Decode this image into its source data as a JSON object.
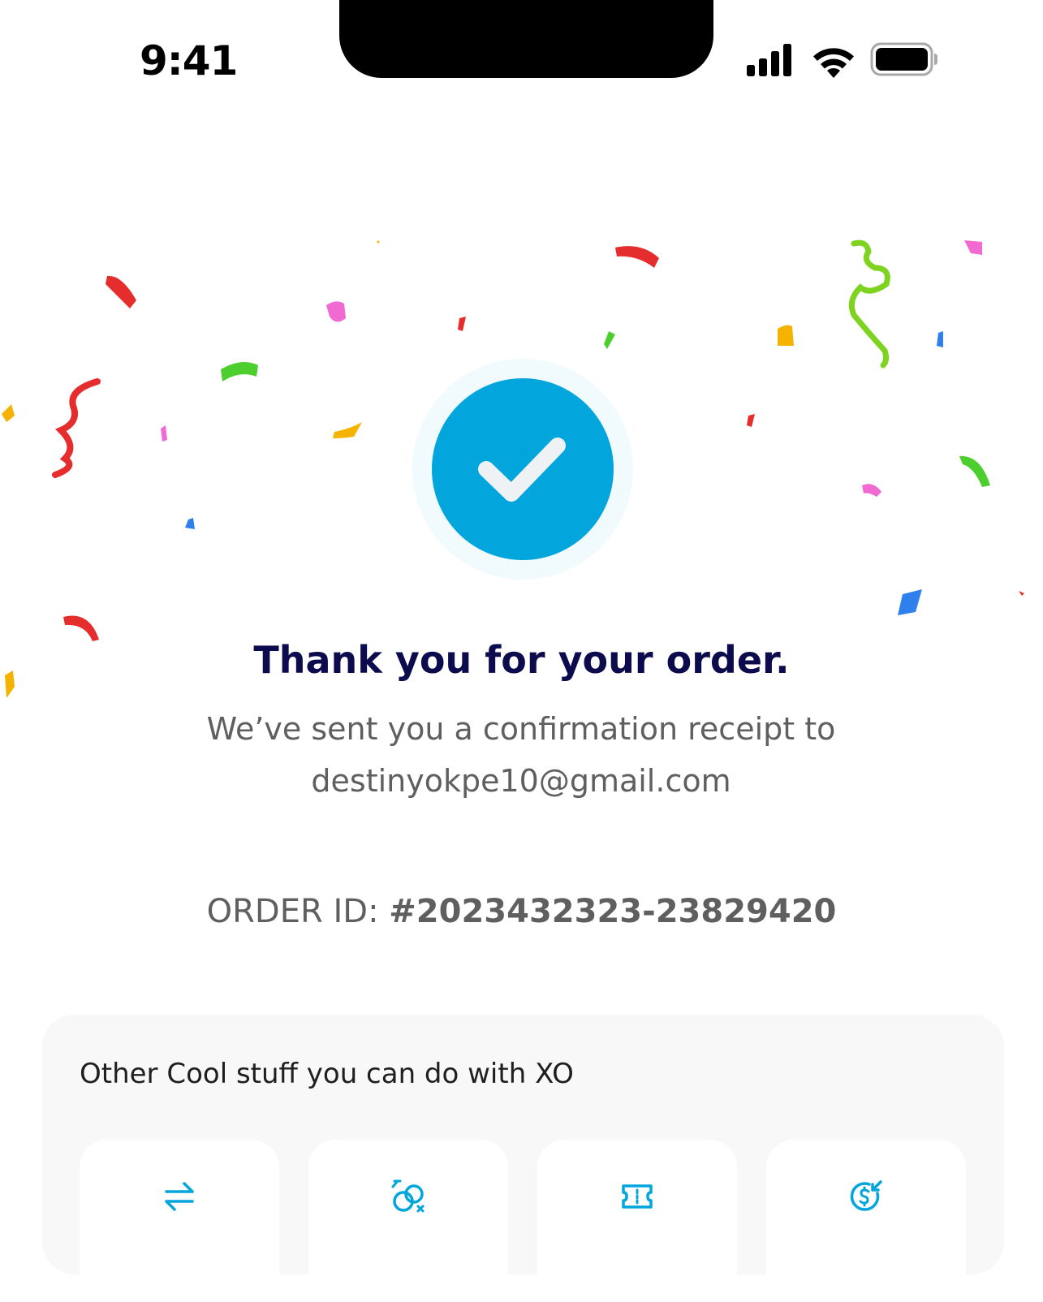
{
  "status_bar": {
    "time": "9:41"
  },
  "confirmation": {
    "icon": "checkmark-icon",
    "title": "Thank you for your order.",
    "message_line1": "We’ve sent you a confirmation receipt to",
    "email": "destinyokpe10@gmail.com",
    "order_label": "ORDER ID:",
    "order_id": "#2023432323-23829420"
  },
  "colors": {
    "accent": "#03a6dc",
    "title": "#0b0b4e",
    "text_muted": "#5f5f5f",
    "card_bg": "#f8f8f8"
  },
  "extras": {
    "title": "Other Cool stuff you can do with XO",
    "actions": [
      {
        "icon": "transfer-arrows-icon"
      },
      {
        "icon": "circles-shapes-icon"
      },
      {
        "icon": "ticket-icon"
      },
      {
        "icon": "dollar-receive-icon"
      }
    ]
  }
}
